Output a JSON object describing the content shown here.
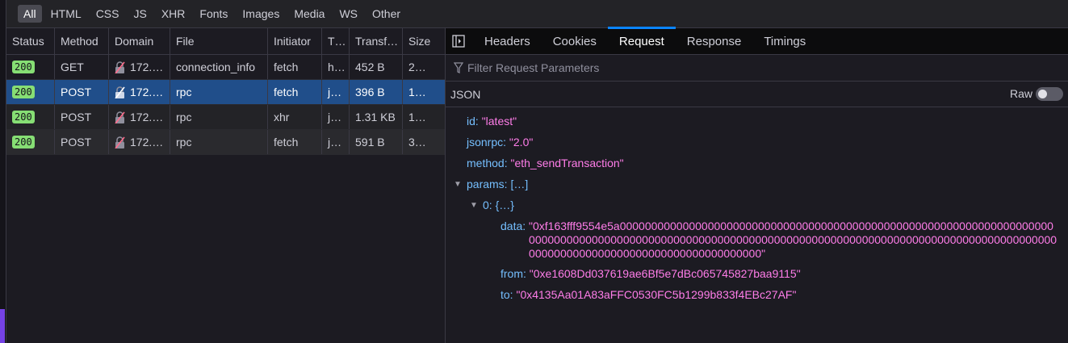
{
  "filters": [
    "All",
    "HTML",
    "CSS",
    "JS",
    "XHR",
    "Fonts",
    "Images",
    "Media",
    "WS",
    "Other"
  ],
  "columns": [
    "Status",
    "Method",
    "Domain",
    "File",
    "Initiator",
    "T…",
    "Transf…",
    "Size"
  ],
  "rows": [
    {
      "status": "200",
      "method": "GET",
      "domain": "172.…",
      "file": "connection_info",
      "initiator": "fetch",
      "type": "h…",
      "transferred": "452 B",
      "size": "2…"
    },
    {
      "status": "200",
      "method": "POST",
      "domain": "172.…",
      "file": "rpc",
      "initiator": "fetch",
      "type": "j…",
      "transferred": "396 B",
      "size": "1…"
    },
    {
      "status": "200",
      "method": "POST",
      "domain": "172.…",
      "file": "rpc",
      "initiator": "xhr",
      "type": "j…",
      "transferred": "1.31 KB",
      "size": "1…"
    },
    {
      "status": "200",
      "method": "POST",
      "domain": "172.…",
      "file": "rpc",
      "initiator": "fetch",
      "type": "j…",
      "transferred": "591 B",
      "size": "3…"
    }
  ],
  "detail_tabs": [
    "Headers",
    "Cookies",
    "Request",
    "Response",
    "Timings"
  ],
  "filter_placeholder": "Filter Request Parameters",
  "json_label": "JSON",
  "raw_label": "Raw",
  "tree": {
    "id_key": "id:",
    "id_val": "\"latest\"",
    "jsonrpc_key": "jsonrpc:",
    "jsonrpc_val": "\"2.0\"",
    "method_key": "method:",
    "method_val": "\"eth_sendTransaction\"",
    "params_key": "params:",
    "params_val": "[…]",
    "zero_key": "0:",
    "zero_val": "{…}",
    "data_key": "data:",
    "data_val": "\"0xf163fff9554e5a0000000000000000000000000000000000000000000000000000000000000000000000000000000000000000000000000000000000000000000000000000000000000000000000000000000000000000000000000000000000000000000000\"",
    "from_key": "from:",
    "from_val": "\"0xe1608Dd037619ae6Bf5e7dBc065745827baa9115\"",
    "to_key": "to:",
    "to_val": "\"0x4135Aa01A83aFFC0530FC5b1299b833f4EBc27AF\""
  }
}
